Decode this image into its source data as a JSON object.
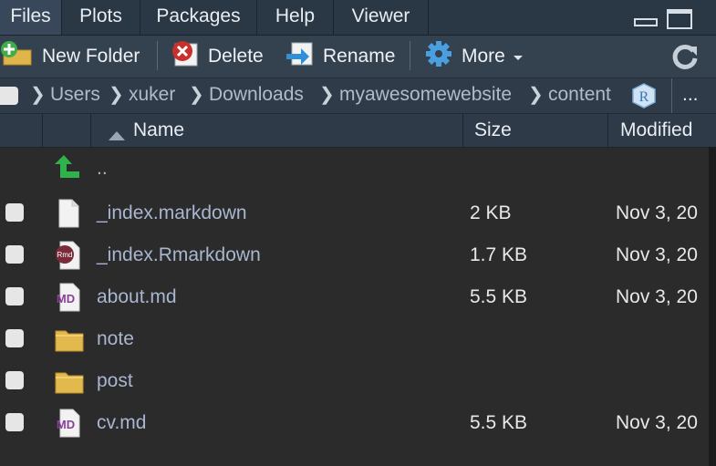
{
  "tabs": [
    "Files",
    "Plots",
    "Packages",
    "Help",
    "Viewer"
  ],
  "toolbar": {
    "new_folder": "New Folder",
    "delete": "Delete",
    "rename": "Rename",
    "more": "More",
    "refresh_icon": "refresh-icon"
  },
  "breadcrumb": [
    "Users",
    "xuker",
    "Downloads",
    "myawesomewebsite",
    "content"
  ],
  "breadcrumb_more": "...",
  "columns": {
    "name": "Name",
    "size": "Size",
    "modified": "Modified"
  },
  "parent": "..",
  "files": [
    {
      "name": "_index.markdown",
      "size": "2 KB",
      "modified": "Nov 3, 20",
      "icon": "blank-file-icon"
    },
    {
      "name": "_index.Rmarkdown",
      "size": "1.7 KB",
      "modified": "Nov 3, 20",
      "icon": "rmd-file-icon"
    },
    {
      "name": "about.md",
      "size": "5.5 KB",
      "modified": "Nov 3, 20",
      "icon": "md-file-icon"
    },
    {
      "name": "note",
      "size": "",
      "modified": "",
      "icon": "folder-icon"
    },
    {
      "name": "post",
      "size": "",
      "modified": "",
      "icon": "folder-icon"
    },
    {
      "name": "cv.md",
      "size": "5.5 KB",
      "modified": "Nov 3, 20",
      "icon": "md-file-icon"
    }
  ],
  "colors": {
    "tab_bar": "#2a3744",
    "toolbar": "#34414f",
    "list_bg": "#2b2b2b",
    "file_link": "#a9b6cf"
  }
}
